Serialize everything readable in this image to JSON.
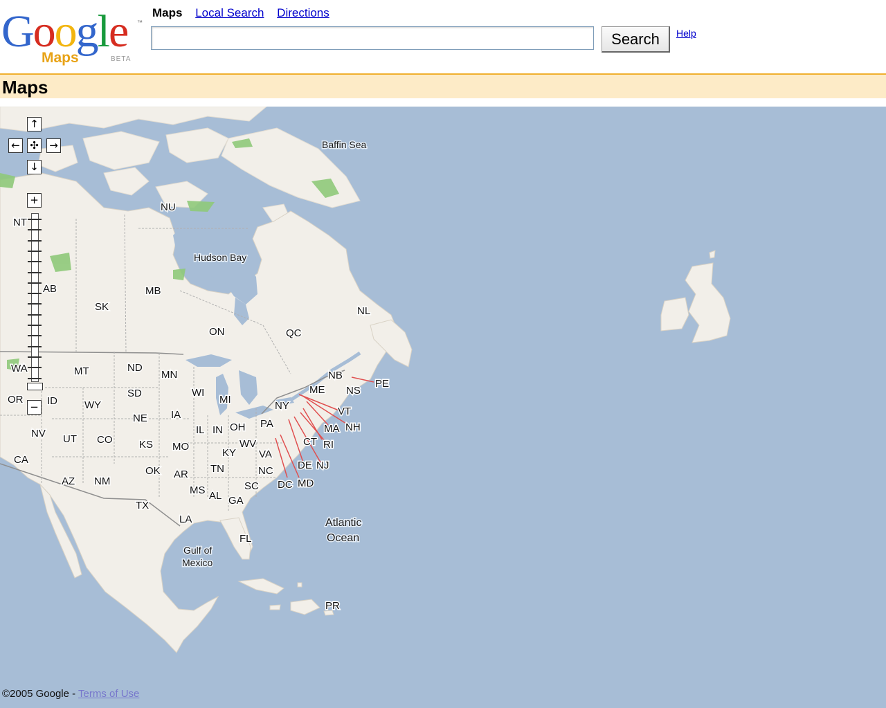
{
  "logo": {
    "google_letters": [
      {
        "ch": "G",
        "color": "#3366cc"
      },
      {
        "ch": "o",
        "color": "#d62d20"
      },
      {
        "ch": "o",
        "color": "#f2b50f"
      },
      {
        "ch": "g",
        "color": "#3366cc"
      },
      {
        "ch": "l",
        "color": "#189a3c"
      },
      {
        "ch": "e",
        "color": "#d62d20"
      }
    ],
    "tm": "™",
    "product": "Maps",
    "beta": "BETA"
  },
  "nav": {
    "current_tab": "Maps",
    "local_search": "Local Search",
    "directions": "Directions"
  },
  "search": {
    "value": "",
    "placeholder": "",
    "button_label": "Search"
  },
  "help_link": "Help",
  "page_title": "Maps",
  "map": {
    "colors": {
      "water": "#a7bdd6",
      "land": "#f2efe9",
      "park": "#8fc97a",
      "border": "#8f8f8f",
      "callout": "#e05050"
    },
    "labels": {
      "baffin_sea": "Baffin Sea",
      "hudson_bay": "Hudson Bay",
      "atlantic_1": "Atlantic",
      "atlantic_2": "Ocean",
      "gulf_1": "Gulf of",
      "gulf_2": "Mexico",
      "NU": "NU",
      "NT": "NT",
      "AB": "AB",
      "SK": "SK",
      "MB": "MB",
      "ON": "ON",
      "QC": "QC",
      "NL": "NL",
      "NB": "NB",
      "NS": "NS",
      "PE": "PE",
      "WA": "WA",
      "OR": "OR",
      "CA": "CA",
      "NV": "NV",
      "ID": "ID",
      "MT": "MT",
      "WY": "WY",
      "UT": "UT",
      "CO": "CO",
      "AZ": "AZ",
      "NM": "NM",
      "ND": "ND",
      "SD": "SD",
      "NE": "NE",
      "KS": "KS",
      "OK": "OK",
      "TX": "TX",
      "MN": "MN",
      "IA": "IA",
      "MO": "MO",
      "AR": "AR",
      "LA": "LA",
      "WI": "WI",
      "IL": "IL",
      "MI": "MI",
      "IN": "IN",
      "OH": "OH",
      "KY": "KY",
      "TN": "TN",
      "MS": "MS",
      "AL": "AL",
      "GA": "GA",
      "FL": "FL",
      "SC": "SC",
      "NC": "NC",
      "VA": "VA",
      "WV": "WV",
      "PA": "PA",
      "NY": "NY",
      "ME": "ME",
      "VT": "VT",
      "NH": "NH",
      "MA": "MA",
      "CT": "CT",
      "RI": "RI",
      "NJ": "NJ",
      "DE": "DE",
      "MD": "MD",
      "DC": "DC",
      "PR": "PR"
    }
  },
  "controls": {
    "pan_up": "↑",
    "pan_left": "←",
    "pan_center": "✣",
    "pan_right": "→",
    "pan_down": "↓",
    "zoom_in": "+",
    "zoom_out": "−",
    "zoom_level": 0
  },
  "footer": {
    "copyright": "©2005 Google - ",
    "terms": "Terms of Use"
  }
}
